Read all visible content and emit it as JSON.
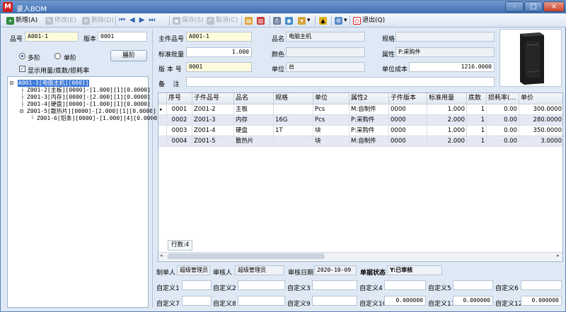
{
  "window": {
    "title": "录入BOM",
    "logo": "M",
    "controls": [
      "-",
      "□",
      "×"
    ]
  },
  "toolbar": [
    {
      "name": "new-button",
      "label": "新增(A)",
      "icon": "new-icon",
      "color": "#2e8b3e",
      "disabled": false
    },
    {
      "name": "edit-button",
      "label": "修改(E)",
      "icon": "edit-icon",
      "color": "#9aa5b4",
      "disabled": true
    },
    {
      "name": "delete-button",
      "label": "删除(D)",
      "icon": "delete-icon",
      "color": "#9aa5b4",
      "disabled": true
    },
    {
      "name": "save-button",
      "label": "保存(S)",
      "icon": "save-icon",
      "color": "#9aa5b4",
      "disabled": true
    },
    {
      "name": "cancel-button",
      "label": "取消(C)",
      "icon": "cancel-icon",
      "color": "#9aa5b4",
      "disabled": true
    },
    {
      "name": "exit-button",
      "label": "退出(Q)",
      "icon": "exit-icon",
      "color": "#d22",
      "disabled": false
    }
  ],
  "left": {
    "part_label": "品号",
    "part_value": "A001-1",
    "version_label": "版本",
    "version_value": "0001",
    "radio_multi": "多阶",
    "radio_single": "单阶",
    "expand_label": "展阶",
    "check_label": "显示用量/底数/损耗率",
    "tree": [
      "A001-1[电脑主机][0001]",
      "Z001-2[主板][0000]-[1.000][1][0.0000]",
      "Z001-3[内存][0000]-[2.000][1][0.0000]",
      "Z001-4[硬盘][0000]-[1.000][1][0.0000]",
      "Z001-5[散热片][0000]-[2.000][1][0.0000]",
      "Z001-6[铝条][0000]-[1.000][4][0.0000]"
    ]
  },
  "header": {
    "main_part_label": "主件品号",
    "main_part_value": "A001-1",
    "std_batch_label": "标准批量",
    "std_batch_value": "1.000",
    "version_label": "版 本 号",
    "version_value": "0001",
    "name_label": "品名",
    "name_value": "电脑主机",
    "color_label": "颜色",
    "color_value": "",
    "unit_label": "单位",
    "unit_value": "台",
    "spec_label": "规格",
    "spec_value": "",
    "attr_label": "属性",
    "attr_value": "P:采购件",
    "unit_cost_label": "单位成本",
    "unit_cost_value": "1216.0000",
    "remark_label": "备    注",
    "remark_value": ""
  },
  "grid": {
    "columns": [
      "序号",
      "子件品号",
      "品名",
      "规格",
      "单位",
      "属性2",
      "子件版本",
      "标准用量",
      "底数",
      "损耗率(…",
      "单价"
    ],
    "rows": [
      [
        "0001",
        "Z001-2",
        "主板",
        "",
        "Pcs",
        "M:自制件",
        "0000",
        "1.000",
        "1",
        "0.00",
        "300.0000"
      ],
      [
        "0002",
        "Z001-3",
        "内存",
        "16G",
        "Pcs",
        "P:采购件",
        "0000",
        "2.000",
        "1",
        "0.00",
        "280.0000"
      ],
      [
        "0003",
        "Z001-4",
        "硬盘",
        "1T",
        "块",
        "P:采购件",
        "0000",
        "1.000",
        "1",
        "0.00",
        "350.0000"
      ],
      [
        "0004",
        "Z001-5",
        "散热片",
        "",
        "块",
        "M:自制件",
        "0000",
        "2.000",
        "1",
        "0.00",
        "3.0000"
      ]
    ],
    "row_count": "行数:4"
  },
  "footer": {
    "maker_label": "制单人",
    "maker_value": "超级管理员",
    "auditor_label": "审核人",
    "auditor_value": "超级管理员",
    "audit_date_label": "审核日期",
    "audit_date_value": "2020-10-09",
    "doc_status_label": "单据状态",
    "doc_status_value": "Y:已审核",
    "custom": [
      {
        "label": "自定义1",
        "value": ""
      },
      {
        "label": "自定义2",
        "value": ""
      },
      {
        "label": "自定义3",
        "value": ""
      },
      {
        "label": "自定义4",
        "value": ""
      },
      {
        "label": "自定义5",
        "value": ""
      },
      {
        "label": "自定义6",
        "value": ""
      },
      {
        "label": "自定义7",
        "value": ""
      },
      {
        "label": "自定义8",
        "value": ""
      },
      {
        "label": "自定义9",
        "value": ""
      },
      {
        "label": "自定义10",
        "value": "0.000000"
      },
      {
        "label": "自定义11",
        "value": "0.000000"
      },
      {
        "label": "自定义12",
        "value": "0.000000"
      }
    ]
  }
}
